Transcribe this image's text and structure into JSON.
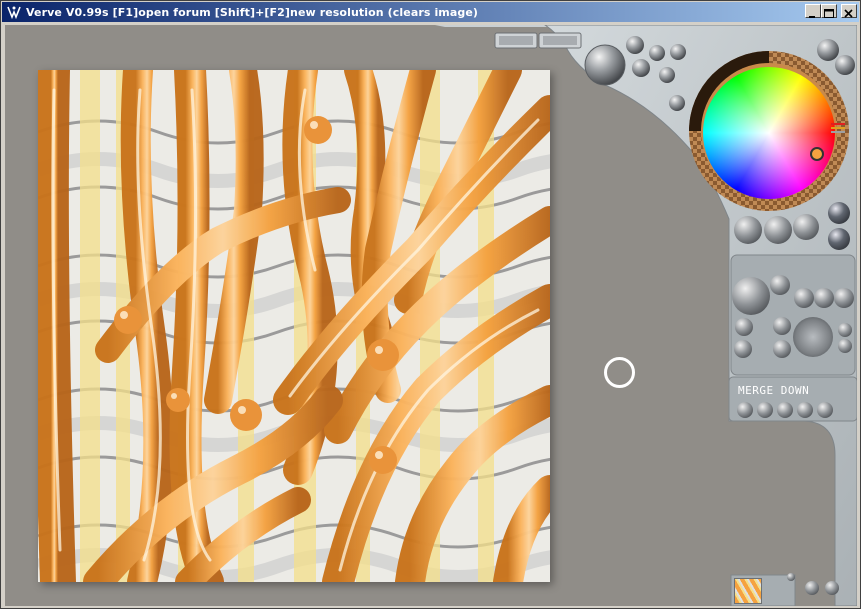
{
  "window": {
    "title": "Verve V0.99s [F1]open forum   [Shift]+[F2]new resolution (clears image)"
  },
  "panel": {
    "merge_label": "MERGE DOWN"
  },
  "colors": {
    "workspace": "#908d88",
    "panel": "#b9bfc2",
    "paint_orange": "#f5a240",
    "paint_yellow": "#f5e08a",
    "title_active": "#0a246a"
  },
  "icons": [
    "app-icon",
    "minimize-icon",
    "maximize-icon",
    "close-icon",
    "color-wheel",
    "brush-cursor"
  ]
}
